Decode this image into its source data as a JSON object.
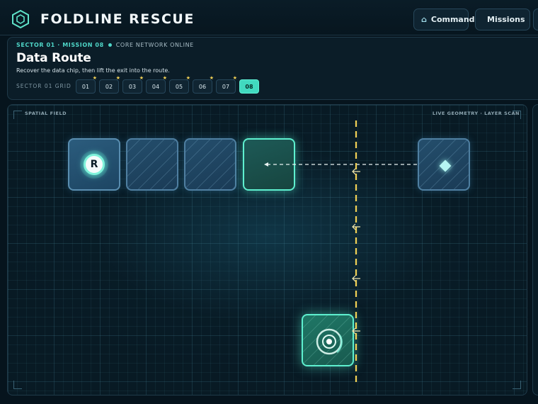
{
  "header": {
    "title": "FOLDLINE RESCUE",
    "nav": {
      "command_label": "Command",
      "missions_label": "Missions"
    }
  },
  "mission": {
    "sector_mission": "SECTOR 01 · MISSION 08",
    "status": "CORE NETWORK ONLINE",
    "title": "Data Route",
    "description": "Recover the data chip, then lift the exit into the route.",
    "grid_label": "SECTOR 01 GRID",
    "levels": [
      {
        "label": "01",
        "starred": true,
        "active": false
      },
      {
        "label": "02",
        "starred": true,
        "active": false
      },
      {
        "label": "03",
        "starred": true,
        "active": false
      },
      {
        "label": "04",
        "starred": true,
        "active": false
      },
      {
        "label": "05",
        "starred": true,
        "active": false
      },
      {
        "label": "06",
        "starred": true,
        "active": false
      },
      {
        "label": "07",
        "starred": true,
        "active": false
      },
      {
        "label": "08",
        "starred": false,
        "active": true
      }
    ]
  },
  "field": {
    "left_label": "SPATIAL FIELD",
    "right_label": "LIVE GEOMETRY · LAYER SCAN",
    "robot_letter": "R"
  },
  "colors": {
    "accent": "#41d9bf",
    "fold_line": "#f3d256",
    "star": "#f3d256",
    "tile_border": "#4f7fa1"
  }
}
